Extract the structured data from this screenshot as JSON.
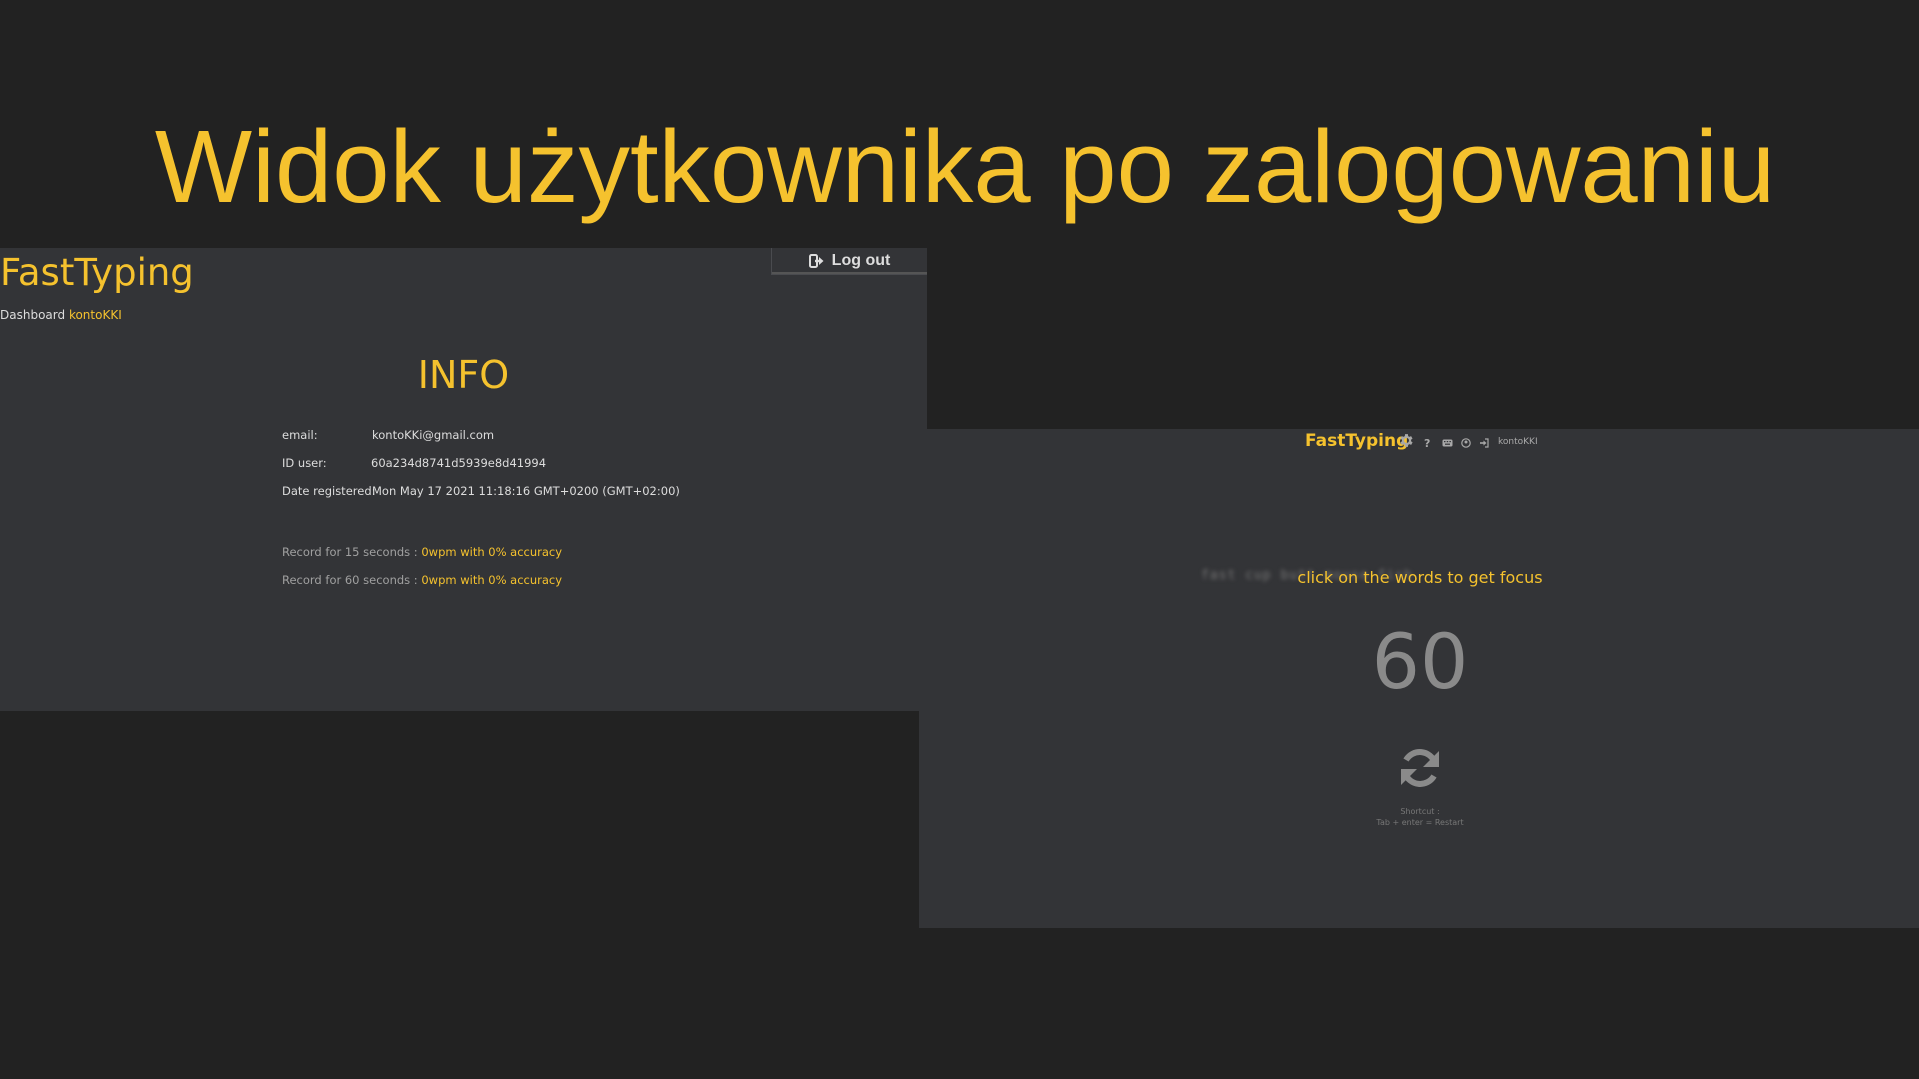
{
  "slide": {
    "title": "Widok użytkownika po zalogowaniu"
  },
  "dashboard": {
    "brand": "FastTyping",
    "breadcrumb": {
      "label": "Dashboard",
      "user": "kontoKKI"
    },
    "logout_label": "Log out",
    "heading": "INFO",
    "fields": [
      {
        "label": "email:",
        "value": "kontoKKi@gmail.com"
      },
      {
        "label": "ID user:",
        "value": "60a234d8741d5939e8d41994"
      },
      {
        "label": "Date registered:",
        "value": "Mon May 17 2021 11:18:16 GMT+0200 (GMT+02:00)"
      }
    ],
    "records": [
      {
        "label": "Record for 15 seconds : ",
        "value": "0wpm with 0% accuracy"
      },
      {
        "label": "Record for 60 seconds : ",
        "value": "0wpm with 0% accuracy"
      }
    ]
  },
  "typing_app": {
    "brand": "FastTyping",
    "nav_icons": [
      "gear-icon",
      "question-icon",
      "keyboard-icon",
      "user-circle-icon",
      "sign-in-icon"
    ],
    "nav_icon_glyphs": {
      "question": "?"
    },
    "username": "kontoKKI",
    "words_preview": "fast cup butt          mouse fish",
    "focus_message": "click on the words to get focus",
    "timer": "60",
    "shortcut_label": "Shortcut :",
    "shortcut_keys": "Tab + enter = Restart"
  },
  "colors": {
    "accent": "#f5c22e",
    "background": "#222222",
    "panel": "#333437",
    "muted_text": "#8a8a8a"
  }
}
